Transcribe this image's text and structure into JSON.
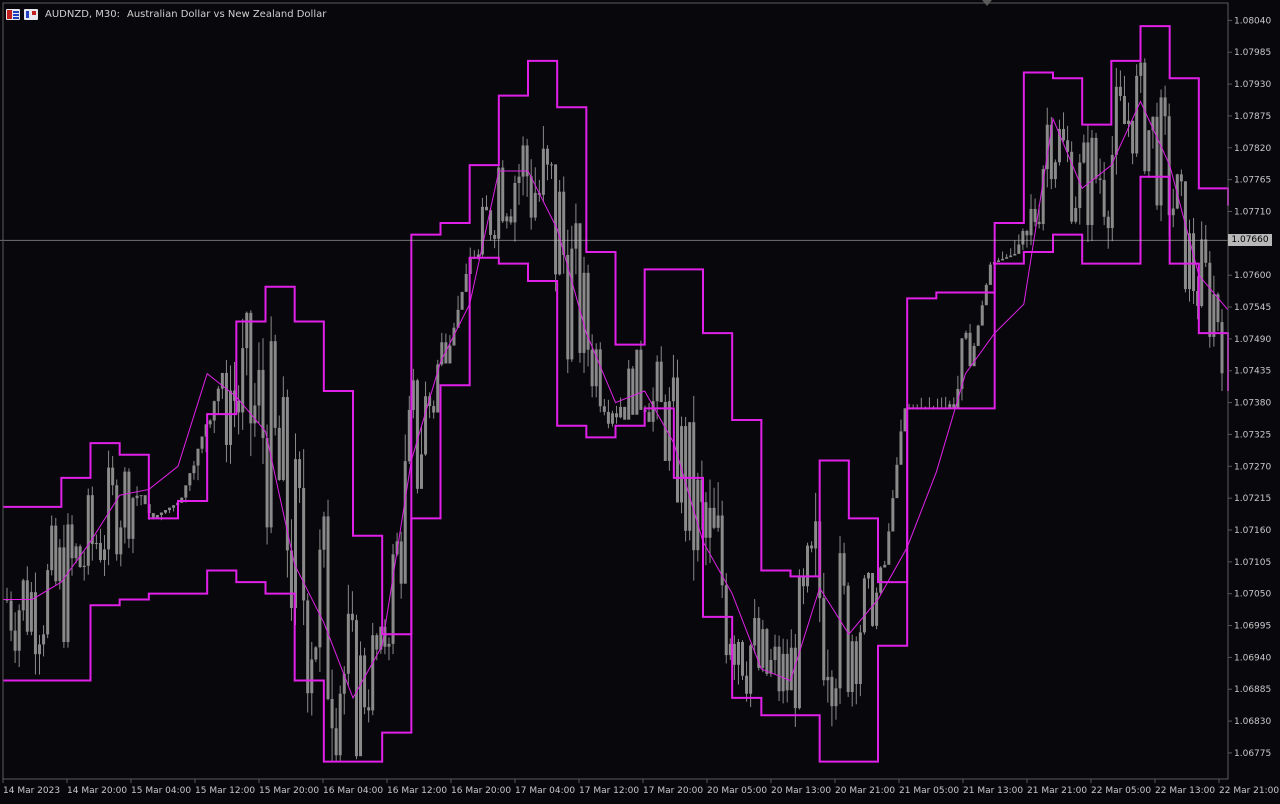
{
  "header": {
    "symbol": "AUDNZD, M30:",
    "description": "Australian Dollar vs New Zealand Dollar",
    "icons": [
      "chart-window-icon",
      "one-click-trading-icon"
    ]
  },
  "colors": {
    "background": "#08080c",
    "candle": "#8a8a8a",
    "band": "#e020e8",
    "axis": "#5a5a5a",
    "crosshair": "#b8b8b8"
  },
  "price_tag": "1.07660",
  "chart_data": {
    "type": "line",
    "title": "",
    "xlabel": "",
    "ylabel": "",
    "ylim": [
      1.0673,
      1.0807
    ],
    "yticks": [
      1.0804,
      1.07985,
      1.0793,
      1.07875,
      1.0782,
      1.07765,
      1.0771,
      1.076,
      1.07545,
      1.0749,
      1.07435,
      1.0738,
      1.07325,
      1.0727,
      1.07215,
      1.0716,
      1.07105,
      1.0705,
      1.06995,
      1.0694,
      1.06885,
      1.0683,
      1.06775
    ],
    "ytick_labels": [
      "1.08040",
      "1.07985",
      "1.07930",
      "1.07875",
      "1.07820",
      "1.07765",
      "1.07710",
      "1.07600",
      "1.07545",
      "1.07490",
      "1.07435",
      "1.07380",
      "1.07325",
      "1.07270",
      "1.07215",
      "1.07160",
      "1.07105",
      "1.07050",
      "1.06995",
      "1.06940",
      "1.06885",
      "1.06830",
      "1.06775"
    ],
    "xtick_labels": [
      "14 Mar 2023",
      "14 Mar 20:00",
      "15 Mar 04:00",
      "15 Mar 12:00",
      "15 Mar 20:00",
      "16 Mar 04:00",
      "16 Mar 12:00",
      "16 Mar 20:00",
      "17 Mar 04:00",
      "17 Mar 12:00",
      "17 Mar 20:00",
      "20 Mar 05:00",
      "20 Mar 13:00",
      "20 Mar 21:00",
      "21 Mar 05:00",
      "21 Mar 13:00",
      "21 Mar 21:00",
      "22 Mar 05:00",
      "22 Mar 13:00",
      "22 Mar 21:00"
    ],
    "last_price": 1.0766,
    "grid": false,
    "series": [
      {
        "role": "upper",
        "values": [
          1.072,
          1.072,
          1.0725,
          1.0731,
          1.0729,
          1.0718,
          1.0721,
          1.0736,
          1.0752,
          1.0758,
          1.0752,
          1.074,
          1.0715,
          1.0698,
          1.0767,
          1.0769,
          1.0779,
          1.0791,
          1.0797,
          1.0789,
          1.0764,
          1.0748,
          1.0761,
          1.0761,
          1.075,
          1.0735,
          1.0709,
          1.0708,
          1.0728,
          1.0718,
          1.0707,
          1.0756,
          1.0757,
          1.0757,
          1.0769,
          1.0795,
          1.0794,
          1.0786,
          1.0797,
          1.0803,
          1.0794,
          1.0775,
          1.0772
        ]
      },
      {
        "role": "middle",
        "values": [
          1.0704,
          1.0704,
          1.0707,
          1.0714,
          1.0722,
          1.0723,
          1.0727,
          1.0743,
          1.0739,
          1.0733,
          1.071,
          1.07,
          1.0687,
          1.0696,
          1.0728,
          1.0745,
          1.0755,
          1.0778,
          1.0778,
          1.0768,
          1.075,
          1.0738,
          1.074,
          1.0731,
          1.0714,
          1.0705,
          1.0692,
          1.069,
          1.0706,
          1.0698,
          1.0704,
          1.0713,
          1.0726,
          1.0743,
          1.075,
          1.0755,
          1.0787,
          1.0775,
          1.0779,
          1.079,
          1.0779,
          1.076,
          1.0754
        ]
      },
      {
        "role": "lower",
        "values": [
          1.069,
          1.069,
          1.069,
          1.0703,
          1.0704,
          1.0705,
          1.0705,
          1.0709,
          1.0707,
          1.0705,
          1.069,
          1.0676,
          1.0676,
          1.0681,
          1.0718,
          1.0741,
          1.0763,
          1.0762,
          1.0759,
          1.0734,
          1.0732,
          1.0734,
          1.0737,
          1.0725,
          1.0701,
          1.0687,
          1.0684,
          1.0684,
          1.0676,
          1.0676,
          1.0696,
          1.0737,
          1.0737,
          1.0737,
          1.0762,
          1.0764,
          1.0767,
          1.0762,
          1.0762,
          1.0777,
          1.0762,
          1.075,
          1.074
        ]
      }
    ]
  }
}
